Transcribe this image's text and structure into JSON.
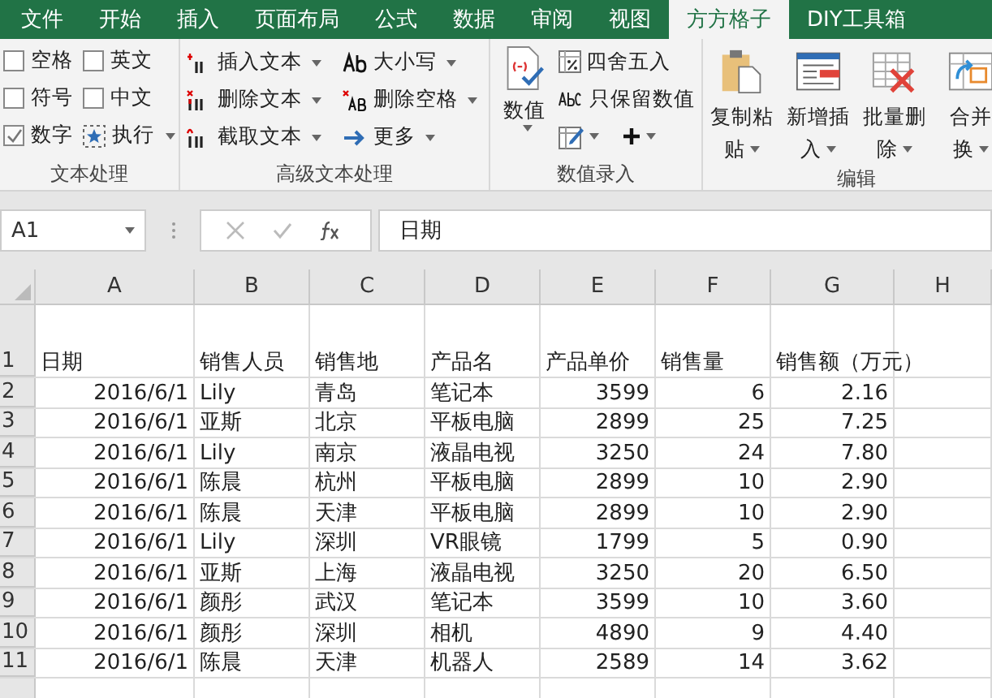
{
  "tabs": [
    {
      "label": "文件",
      "selected": false
    },
    {
      "label": "开始",
      "selected": false
    },
    {
      "label": "插入",
      "selected": false
    },
    {
      "label": "页面布局",
      "selected": false
    },
    {
      "label": "公式",
      "selected": false
    },
    {
      "label": "数据",
      "selected": false
    },
    {
      "label": "审阅",
      "selected": false
    },
    {
      "label": "视图",
      "selected": false
    },
    {
      "label": "方方格子",
      "selected": true
    },
    {
      "label": "DIY工具箱",
      "selected": false
    }
  ],
  "ribbon": {
    "text_group": {
      "title": "文本处理",
      "checkboxes": [
        {
          "label": "空格",
          "checked": false
        },
        {
          "label": "符号",
          "checked": false
        },
        {
          "label": "数字",
          "checked": true
        },
        {
          "label": "英文",
          "checked": false
        },
        {
          "label": "中文",
          "checked": false
        }
      ],
      "run_button": "执行"
    },
    "advanced_group": {
      "title": "高级文本处理",
      "buttons": [
        {
          "kind": "insert",
          "label": "插入文本"
        },
        {
          "kind": "delete",
          "label": "删除文本"
        },
        {
          "kind": "extract",
          "label": "截取文本"
        },
        {
          "kind": "case",
          "label": "大小写"
        },
        {
          "kind": "space",
          "label": "删除空格"
        },
        {
          "kind": "more",
          "label": "更多"
        }
      ]
    },
    "number_group": {
      "title": "数值录入",
      "big_button": "数值",
      "round_button": "四舍五入",
      "keep_button": "只保留数值"
    },
    "edit_group": {
      "title": "编辑",
      "buttons": [
        {
          "kind": "paste",
          "lines": [
            "复制粘",
            "贴"
          ]
        },
        {
          "kind": "insert",
          "lines": [
            "新增插",
            "入"
          ]
        },
        {
          "kind": "delete",
          "lines": [
            "批量删",
            "除"
          ]
        },
        {
          "kind": "merge",
          "lines": [
            "合并",
            "换"
          ]
        }
      ]
    }
  },
  "formula_bar": {
    "name_box": "A1",
    "formula": "日期"
  },
  "sheet": {
    "columns": [
      "A",
      "B",
      "C",
      "D",
      "E",
      "F",
      "G",
      "H"
    ],
    "header_row": {
      "number": "1",
      "cells": [
        "日期",
        "销售人员",
        "销售地",
        "产品名",
        "产品单价",
        "销售量",
        "销售额（万元）"
      ]
    },
    "rows": [
      {
        "number": "2",
        "cells": [
          "2016/6/1",
          "Lily",
          "青岛",
          "笔记本",
          "3599",
          "6",
          "2.16"
        ]
      },
      {
        "number": "3",
        "cells": [
          "2016/6/1",
          "亚斯",
          "北京",
          "平板电脑",
          "2899",
          "25",
          "7.25"
        ]
      },
      {
        "number": "4",
        "cells": [
          "2016/6/1",
          "Lily",
          "南京",
          "液晶电视",
          "3250",
          "24",
          "7.80"
        ]
      },
      {
        "number": "5",
        "cells": [
          "2016/6/1",
          "陈晨",
          "杭州",
          "平板电脑",
          "2899",
          "10",
          "2.90"
        ]
      },
      {
        "number": "6",
        "cells": [
          "2016/6/1",
          "陈晨",
          "天津",
          "平板电脑",
          "2899",
          "10",
          "2.90"
        ]
      },
      {
        "number": "7",
        "cells": [
          "2016/6/1",
          "Lily",
          "深圳",
          "VR眼镜",
          "1799",
          "5",
          "0.90"
        ]
      },
      {
        "number": "8",
        "cells": [
          "2016/6/1",
          "亚斯",
          "上海",
          "液晶电视",
          "3250",
          "20",
          "6.50"
        ]
      },
      {
        "number": "9",
        "cells": [
          "2016/6/1",
          "颜彤",
          "武汉",
          "笔记本",
          "3599",
          "10",
          "3.60"
        ]
      },
      {
        "number": "10",
        "cells": [
          "2016/6/1",
          "颜彤",
          "深圳",
          "相机",
          "4890",
          "9",
          "4.40"
        ]
      },
      {
        "number": "11",
        "cells": [
          "2016/6/1",
          "陈晨",
          "天津",
          "机器人",
          "2589",
          "14",
          "3.62"
        ]
      }
    ]
  }
}
